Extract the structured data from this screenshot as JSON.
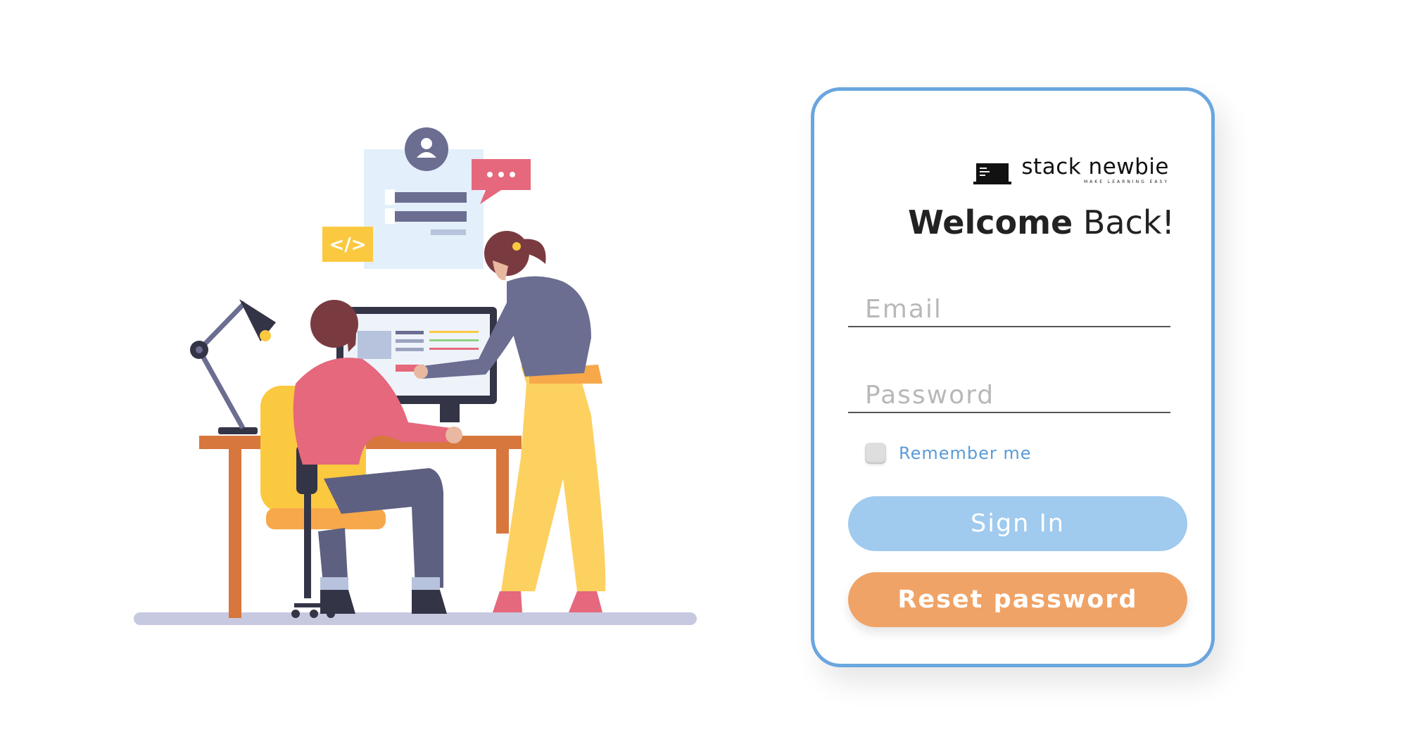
{
  "brand": {
    "name": "stack newbie",
    "tagline": "MAKE LEARNING EASY"
  },
  "heading": {
    "bold": "Welcome",
    "light": "Back!"
  },
  "form": {
    "email_placeholder": "Email",
    "password_placeholder": "Password",
    "remember_label": "Remember me",
    "remember_checked": false,
    "signin_label": "Sign In",
    "reset_label": "Reset password"
  },
  "illustration": {
    "code_tag": "</>"
  },
  "colors": {
    "card_border": "#6aa6df",
    "signin_bg": "#a0caee",
    "reset_bg": "#f0a366",
    "link": "#5b9bd5"
  }
}
